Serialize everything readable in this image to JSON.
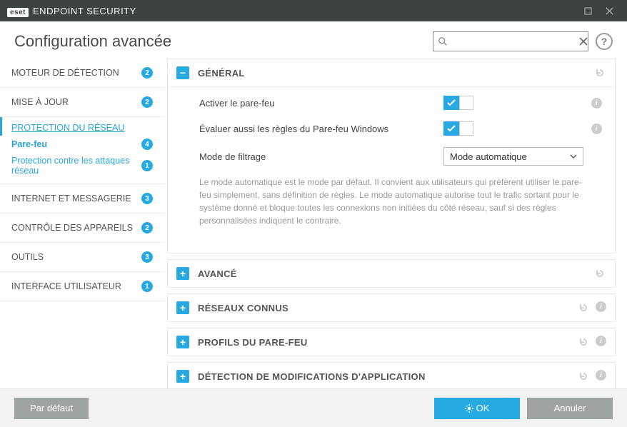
{
  "titlebar": {
    "brand_prefix": "eset",
    "brand_text": "ENDPOINT SECURITY"
  },
  "header": {
    "title": "Configuration avancée",
    "search_placeholder": "",
    "help": "?"
  },
  "sidebar": {
    "items": [
      {
        "label": "MOTEUR DE DÉTECTION",
        "badge": "2"
      },
      {
        "label": "MISE À JOUR",
        "badge": "2"
      },
      {
        "label": "PROTECTION DU RÉSEAU",
        "link": true
      },
      {
        "label": "INTERNET ET MESSAGERIE",
        "badge": "3"
      },
      {
        "label": "CONTRÔLE DES APPAREILS",
        "badge": "2"
      },
      {
        "label": "OUTILS",
        "badge": "3"
      },
      {
        "label": "INTERFACE UTILISATEUR",
        "badge": "1"
      }
    ],
    "subs": [
      {
        "label": "Pare-feu",
        "badge": "4",
        "selected": true
      },
      {
        "label": "Protection contre les attaques réseau",
        "badge": "1"
      }
    ]
  },
  "panels": {
    "general": {
      "title": "GÉNÉRAL",
      "rows": {
        "enable_fw": "Activer le pare-feu",
        "eval_win": "Évaluer aussi les règles du Pare-feu Windows",
        "filter_mode": "Mode de filtrage",
        "filter_mode_value": "Mode automatique"
      },
      "desc": "Le mode automatique est le mode par défaut. Il convient aux utilisateurs qui préfèrent utiliser le pare-feu simplement, sans définition de règles. Le mode automatique autorise tout le trafic sortant pour le système donné et bloque toutes les connexions non initiées du côté réseau, sauf si des règles personnalisées indiquent le contraire."
    },
    "advanced": {
      "title": "AVANCÉ"
    },
    "known_nets": {
      "title": "RÉSEAUX CONNUS"
    },
    "fw_profiles": {
      "title": "PROFILS DU PARE-FEU"
    },
    "app_mod": {
      "title": "DÉTECTION DE MODIFICATIONS D'APPLICATION"
    }
  },
  "footer": {
    "default": "Par défaut",
    "ok": "OK",
    "cancel": "Annuler"
  },
  "icons": {
    "info": "i",
    "minus": "−",
    "plus": "+"
  }
}
